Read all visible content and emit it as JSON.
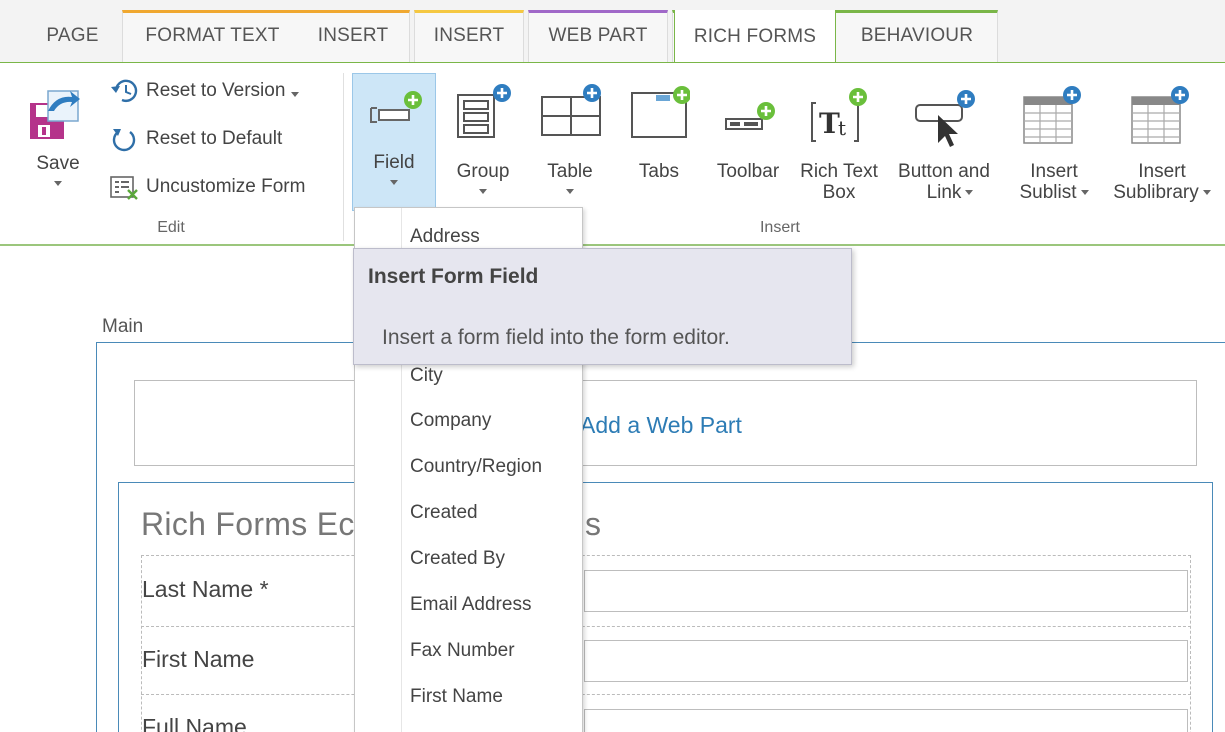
{
  "tabs": {
    "page": "PAGE",
    "format_text": "FORMAT TEXT",
    "insert_1": "INSERT",
    "insert_2": "INSERT",
    "web_part": "WEB PART",
    "rich_forms": "RICH FORMS",
    "behaviour": "BEHAVIOUR"
  },
  "ribbon": {
    "edit_group": {
      "label": "Edit",
      "save": "Save",
      "reset_version": "Reset to Version",
      "reset_default": "Reset to Default",
      "uncustomize": "Uncustomize Form"
    },
    "insert_group": {
      "label": "Insert",
      "field": "Field",
      "group": "Group",
      "table": "Table",
      "tabs": "Tabs",
      "toolbar": "Toolbar",
      "rich_text_1": "Rich Text",
      "rich_text_2": "Box",
      "button_link_1": "Button and",
      "button_link_2": "Link",
      "insert_sublist_1": "Insert",
      "insert_sublist_2": "Sublist",
      "insert_sublibrary_1": "Insert",
      "insert_sublibrary_2": "Sublibrary"
    }
  },
  "dropdown": {
    "items": [
      "Address",
      "City",
      "Company",
      "Country/Region",
      "Created",
      "Created By",
      "Email Address",
      "Fax Number",
      "First Name"
    ]
  },
  "tooltip": {
    "title": "Insert Form Field",
    "body": "Insert a form field into the form editor."
  },
  "content": {
    "zone_label": "Main",
    "add_web_part": "Add a Web Part",
    "form_title": "Rich Forms Ec",
    "form_title_tail": "s",
    "rows": [
      "Last Name *",
      "First Name",
      "Full Name"
    ]
  },
  "colors": {
    "accent_green": "#7ab648",
    "selected_blue": "#cde6f7",
    "link_blue": "#2d7cb5",
    "save_magenta": "#b5338a"
  }
}
